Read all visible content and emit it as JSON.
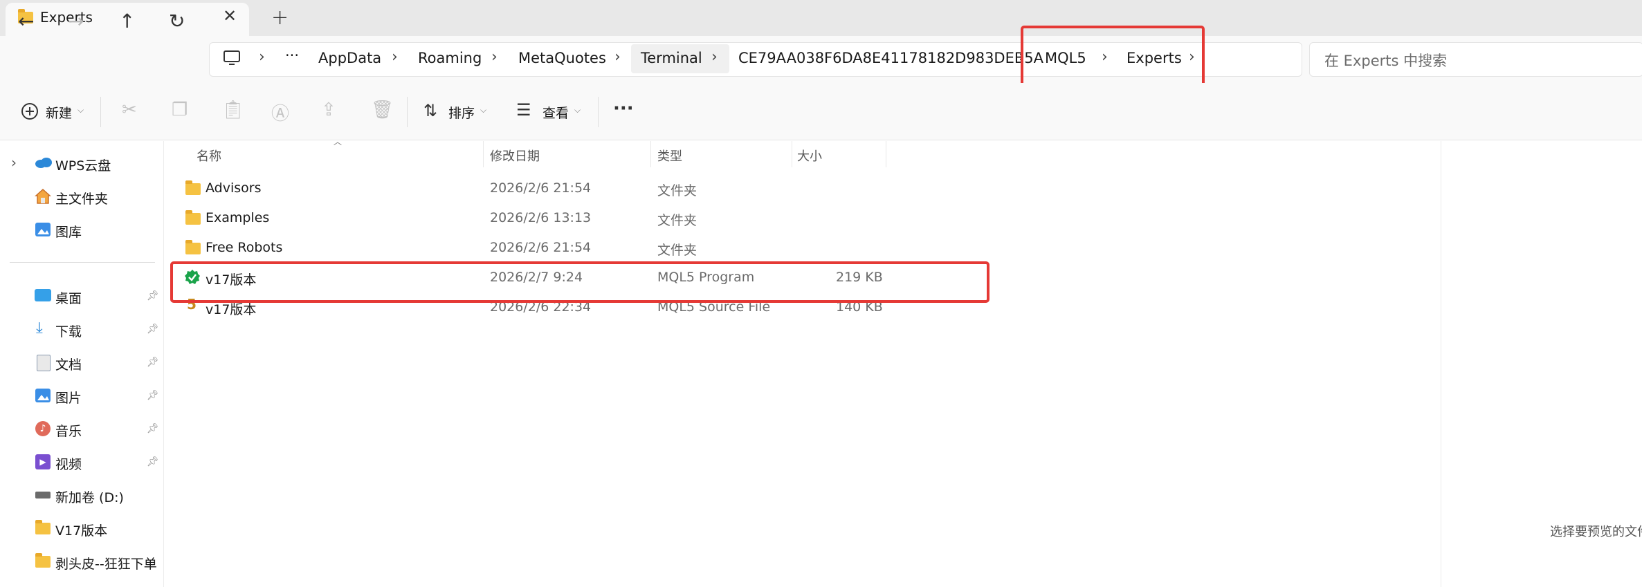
{
  "window": {
    "tab_title": "Experts",
    "new_tab": "+",
    "close": "✕"
  },
  "nav": {
    "back": "←",
    "forward": "→",
    "up": "↑",
    "refresh": "↻",
    "more": "···"
  },
  "breadcrumb": {
    "items": [
      "AppData",
      "Roaming",
      "MetaQuotes",
      "Terminal",
      "CE79AA038F6DA8E41178182D983DEB5A",
      "MQL5",
      "Experts"
    ],
    "separator": "›"
  },
  "search": {
    "placeholder": "在 Experts 中搜索"
  },
  "toolbar": {
    "new_label": "新建",
    "sort_label": "排序",
    "view_label": "查看",
    "more": "···"
  },
  "sidebar": {
    "top_items": [
      {
        "label": "WPS云盘",
        "icon": "cloud-icon"
      },
      {
        "label": "主文件夹",
        "icon": "home-icon"
      },
      {
        "label": "图库",
        "icon": "gallery-icon"
      }
    ],
    "quick_items": [
      {
        "label": "桌面",
        "icon": "desktop-icon",
        "pinned": true
      },
      {
        "label": "下载",
        "icon": "download-icon",
        "pinned": true
      },
      {
        "label": "文档",
        "icon": "document-icon",
        "pinned": true
      },
      {
        "label": "图片",
        "icon": "pictures-icon",
        "pinned": true
      },
      {
        "label": "音乐",
        "icon": "music-icon",
        "pinned": true
      },
      {
        "label": "视频",
        "icon": "video-icon",
        "pinned": true
      },
      {
        "label": "新加卷 (D:)",
        "icon": "drive-icon",
        "pinned": false
      },
      {
        "label": "V17版本",
        "icon": "folder-icon",
        "pinned": false
      },
      {
        "label": "剥头皮--狂狂下单",
        "icon": "folder-icon",
        "pinned": false
      }
    ]
  },
  "columns": [
    "名称",
    "修改日期",
    "类型",
    "大小"
  ],
  "files": [
    {
      "name": "Advisors",
      "date": "2026/2/6 21:54",
      "type": "文件夹",
      "size": "",
      "icon": "folder-icon"
    },
    {
      "name": "Examples",
      "date": "2026/2/6 13:13",
      "type": "文件夹",
      "size": "",
      "icon": "folder-icon"
    },
    {
      "name": "Free Robots",
      "date": "2026/2/6 21:54",
      "type": "文件夹",
      "size": "",
      "icon": "folder-icon"
    },
    {
      "name": "v17版本",
      "date": "2026/2/7 9:24",
      "type": "MQL5 Program",
      "size": "219 KB",
      "icon": "mql5-program-icon"
    },
    {
      "name": "v17版本",
      "date": "2026/2/6 22:34",
      "type": "MQL5 Source File",
      "size": "140 KB",
      "icon": "mql5-source-icon"
    }
  ],
  "preview": {
    "text": "选择要预览的文件"
  },
  "colors": {
    "highlight": "#e53935",
    "folder": "#f5c242",
    "program_icon": "#1aa34a"
  }
}
